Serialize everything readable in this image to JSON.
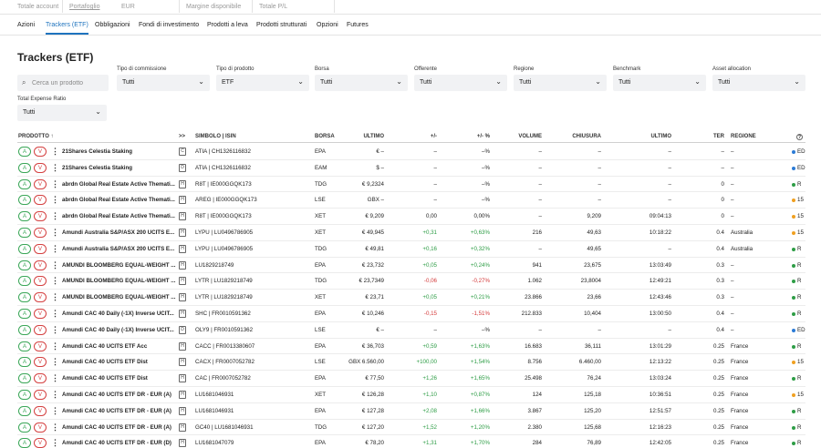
{
  "topbar": {
    "labels": [
      "Totale account",
      "Portafoglio",
      "EUR",
      "Margine disponibile",
      "Totale P/L"
    ]
  },
  "nav": {
    "tabs": [
      "Azioni",
      "Trackers (ETF)",
      "Obbligazioni",
      "Fondi di investimento",
      "Prodotti a leva",
      "Prodotti strutturati",
      "Opzioni",
      "Futures"
    ],
    "active_tab": "Trackers (ETF)"
  },
  "page_title": "Trackers (ETF)",
  "filters": {
    "search_placeholder": "Cerca un prodotto",
    "commission": {
      "label": "Tipo di commissione",
      "value": "Tutti"
    },
    "product_type": {
      "label": "Tipo di prodotto",
      "value": "ETF"
    },
    "exchange": {
      "label": "Borsa",
      "value": "Tutti"
    },
    "issuer": {
      "label": "Offerente",
      "value": "Tutti"
    },
    "region": {
      "label": "Regione",
      "value": "Tutti"
    },
    "benchmark": {
      "label": "Benchmark",
      "value": "Tutti"
    },
    "asset_allocation": {
      "label": "Asset allocation",
      "value": "Tutti"
    },
    "ter": {
      "label": "Total Expense Ratio",
      "value": "Tutti"
    }
  },
  "table": {
    "headers": {
      "product": "PRODOTTO ↑",
      "expand": ">>",
      "symbol": "SIMBOLO | ISIN",
      "exchange": "BORSA",
      "last": "ULTIMO",
      "change": "+/-",
      "change_pct": "+/- %",
      "volume": "VOLUME",
      "close": "CHIUSURA",
      "last_time": "ULTIMO",
      "ter": "TER",
      "region": "REGIONE",
      "help": "?"
    },
    "buy_label": "A",
    "sell_label": "V",
    "rows": [
      {
        "name": "21Shares Celestia Staking",
        "doc": "C",
        "symbol": "ATIA | CH1326116832",
        "exchange": "EPA",
        "last": "€ –",
        "change": "–",
        "change_pct": "–%",
        "volume": "–",
        "close": "–",
        "time": "–",
        "ter": "–",
        "region": "–",
        "status": "ED",
        "status_color": "#2b7bd6"
      },
      {
        "name": "21Shares Celestia Staking",
        "doc": "D",
        "symbol": "ATIA | CH1326116832",
        "exchange": "EAM",
        "last": "$ –",
        "change": "–",
        "change_pct": "–%",
        "volume": "–",
        "close": "–",
        "time": "–",
        "ter": "–",
        "region": "–",
        "status": "ED",
        "status_color": "#2b7bd6"
      },
      {
        "name": "abrdn Global Real Estate Active Themati...",
        "doc": "H",
        "symbol": "R8T | IE000GGQK173",
        "exchange": "TDG",
        "last": "€ 9,2324",
        "change": "–",
        "change_pct": "–%",
        "volume": "–",
        "close": "–",
        "time": "–",
        "ter": "0",
        "region": "–",
        "status": "R",
        "status_color": "#2e9d46"
      },
      {
        "name": "abrdn Global Real Estate Active Themati...",
        "doc": "H",
        "symbol": "AREG | IE000GGQK173",
        "exchange": "LSE",
        "last": "GBX –",
        "change": "–",
        "change_pct": "–%",
        "volume": "–",
        "close": "–",
        "time": "–",
        "ter": "0",
        "region": "–",
        "status": "15",
        "status_color": "#f0a020"
      },
      {
        "name": "abrdn Global Real Estate Active Themati...",
        "doc": "H",
        "symbol": "R8T | IE000GGQK173",
        "exchange": "XET",
        "last": "€ 9,209",
        "change": "0,00",
        "change_pct": "0,00%",
        "volume": "–",
        "close": "9,209",
        "time": "09:04:13",
        "ter": "0",
        "region": "–",
        "status": "15",
        "status_color": "#f0a020"
      },
      {
        "name": "Amundi Australia S&P/ASX 200 UCITS E...",
        "doc": "H",
        "symbol": "LYPU | LU0496786905",
        "exchange": "XET",
        "last": "€ 49,945",
        "change": "+0,31",
        "change_pct": "+0,63%",
        "volume": "216",
        "close": "49,63",
        "time": "10:18:22",
        "ter": "0.4",
        "region": "Australia",
        "status": "15",
        "status_color": "#f0a020"
      },
      {
        "name": "Amundi Australia S&P/ASX 200 UCITS E...",
        "doc": "H",
        "symbol": "LYPU | LU0496786905",
        "exchange": "TDG",
        "last": "€ 49,81",
        "change": "+0,16",
        "change_pct": "+0,32%",
        "volume": "–",
        "close": "49,65",
        "time": "–",
        "ter": "0.4",
        "region": "Australia",
        "status": "R",
        "status_color": "#2e9d46"
      },
      {
        "name": "AMUNDI BLOOMBERG EQUAL-WEIGHT ...",
        "doc": "H",
        "symbol": "LU1829218749",
        "exchange": "EPA",
        "last": "€ 23,732",
        "change": "+0,05",
        "change_pct": "+0,24%",
        "volume": "941",
        "close": "23,675",
        "time": "13:03:49",
        "ter": "0.3",
        "region": "–",
        "status": "R",
        "status_color": "#2e9d46"
      },
      {
        "name": "AMUNDI BLOOMBERG EQUAL-WEIGHT ...",
        "doc": "H",
        "symbol": "LYTR | LU1829218749",
        "exchange": "TDG",
        "last": "€ 23,7349",
        "change": "-0,06",
        "change_pct": "-0,27%",
        "volume": "1.062",
        "close": "23,8004",
        "time": "12:49:21",
        "ter": "0.3",
        "region": "–",
        "status": "R",
        "status_color": "#2e9d46"
      },
      {
        "name": "AMUNDI BLOOMBERG EQUAL-WEIGHT ...",
        "doc": "H",
        "symbol": "LYTR | LU1829218749",
        "exchange": "XET",
        "last": "€ 23,71",
        "change": "+0,05",
        "change_pct": "+0,21%",
        "volume": "23.866",
        "close": "23,66",
        "time": "12:43:46",
        "ter": "0.3",
        "region": "–",
        "status": "R",
        "status_color": "#2e9d46"
      },
      {
        "name": "Amundi CAC 40 Daily (-1X) Inverse UCIT...",
        "doc": "H",
        "symbol": "SHC | FR0010591362",
        "exchange": "EPA",
        "last": "€ 10,246",
        "change": "-0,15",
        "change_pct": "-1,51%",
        "volume": "212.833",
        "close": "10,404",
        "time": "13:00:50",
        "ter": "0.4",
        "region": "–",
        "status": "R",
        "status_color": "#2e9d46"
      },
      {
        "name": "Amundi CAC 40 Daily (-1X) Inverse UCIT...",
        "doc": "D",
        "symbol": "OLY9 | FR0010591362",
        "exchange": "LSE",
        "last": "€ –",
        "change": "–",
        "change_pct": "–%",
        "volume": "–",
        "close": "–",
        "time": "–",
        "ter": "0.4",
        "region": "–",
        "status": "ED",
        "status_color": "#2b7bd6"
      },
      {
        "name": "Amundi CAC 40 UCITS ETF Acc",
        "doc": "H",
        "symbol": "CACC | FR0013380607",
        "exchange": "EPA",
        "last": "€ 36,703",
        "change": "+0,59",
        "change_pct": "+1,63%",
        "volume": "16.683",
        "close": "36,111",
        "time": "13:01:29",
        "ter": "0.25",
        "region": "France",
        "status": "R",
        "status_color": "#2e9d46"
      },
      {
        "name": "Amundi CAC 40 UCITS ETF Dist",
        "doc": "H",
        "symbol": "CACX | FR0007052782",
        "exchange": "LSE",
        "last": "GBX 6.560,00",
        "change": "+100,00",
        "change_pct": "+1,54%",
        "volume": "8.756",
        "close": "6.460,00",
        "time": "12:13:22",
        "ter": "0.25",
        "region": "France",
        "status": "15",
        "status_color": "#f0a020"
      },
      {
        "name": "Amundi CAC 40 UCITS ETF Dist",
        "doc": "H",
        "symbol": "CAC | FR0007052782",
        "exchange": "EPA",
        "last": "€ 77,50",
        "change": "+1,26",
        "change_pct": "+1,65%",
        "volume": "25.498",
        "close": "76,24",
        "time": "13:03:24",
        "ter": "0.25",
        "region": "France",
        "status": "R",
        "status_color": "#2e9d46"
      },
      {
        "name": "Amundi CAC 40 UCITS ETF DR - EUR (A)",
        "doc": "H",
        "symbol": "LU1681046931",
        "exchange": "XET",
        "last": "€ 126,28",
        "change": "+1,10",
        "change_pct": "+0,87%",
        "volume": "124",
        "close": "125,18",
        "time": "10:36:51",
        "ter": "0.25",
        "region": "France",
        "status": "15",
        "status_color": "#f0a020"
      },
      {
        "name": "Amundi CAC 40 UCITS ETF DR - EUR (A)",
        "doc": "H",
        "symbol": "LU1681046931",
        "exchange": "EPA",
        "last": "€ 127,28",
        "change": "+2,08",
        "change_pct": "+1,66%",
        "volume": "3.867",
        "close": "125,20",
        "time": "12:51:57",
        "ter": "0.25",
        "region": "France",
        "status": "R",
        "status_color": "#2e9d46"
      },
      {
        "name": "Amundi CAC 40 UCITS ETF DR - EUR (A)",
        "doc": "H",
        "symbol": "GC40 | LU1681046931",
        "exchange": "TDG",
        "last": "€ 127,20",
        "change": "+1,52",
        "change_pct": "+1,20%",
        "volume": "2.380",
        "close": "125,68",
        "time": "12:16:23",
        "ter": "0.25",
        "region": "France",
        "status": "R",
        "status_color": "#2e9d46"
      },
      {
        "name": "Amundi CAC 40 UCITS ETF DR - EUR (D)",
        "doc": "H",
        "symbol": "LU1681047079",
        "exchange": "EPA",
        "last": "€ 78,20",
        "change": "+1,31",
        "change_pct": "+1,70%",
        "volume": "284",
        "close": "76,89",
        "time": "12:42:05",
        "ter": "0.25",
        "region": "France",
        "status": "R",
        "status_color": "#2e9d46"
      }
    ]
  }
}
